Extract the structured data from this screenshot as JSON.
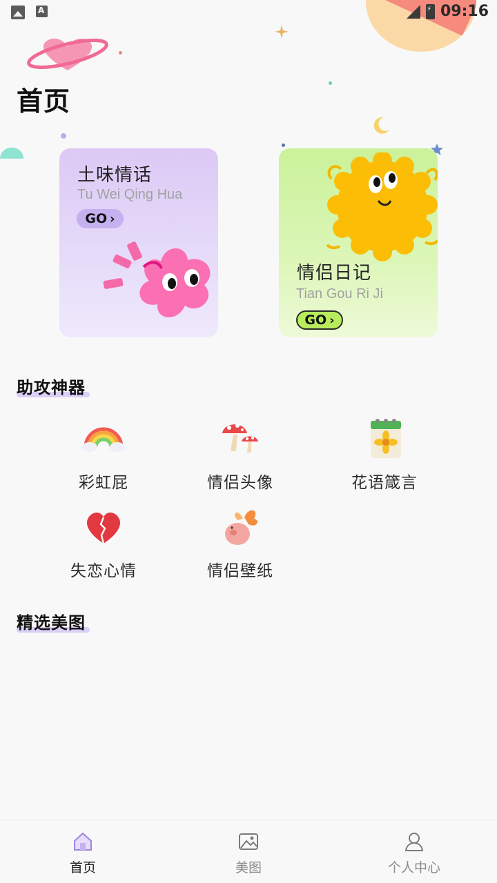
{
  "status_bar": {
    "time": "09:16"
  },
  "header": {
    "title": "首页"
  },
  "cards": [
    {
      "title": "土味情话",
      "subtitle": "Tu Wei Qing Hua",
      "go_label": "GO"
    },
    {
      "title": "情侣日记",
      "subtitle": "Tian Gou Ri Ji",
      "go_label": "GO"
    }
  ],
  "tools_section": {
    "title": "助攻神器",
    "items": [
      {
        "label": "彩虹屁",
        "icon": "rainbow-icon"
      },
      {
        "label": "情侣头像",
        "icon": "mushroom-icon"
      },
      {
        "label": "花语箴言",
        "icon": "flower-calendar-icon"
      },
      {
        "label": "失恋心情",
        "icon": "broken-heart-icon"
      },
      {
        "label": "情侣壁纸",
        "icon": "butterfly-pig-icon"
      }
    ]
  },
  "featured_section": {
    "title": "精选美图"
  },
  "tabbar": {
    "tabs": [
      {
        "label": "首页",
        "icon": "home-icon",
        "active": true
      },
      {
        "label": "美图",
        "icon": "image-icon",
        "active": false
      },
      {
        "label": "个人中心",
        "icon": "profile-icon",
        "active": false
      }
    ]
  },
  "colors": {
    "accent": "#c5b1f0",
    "green_card": "#cbf29a",
    "purple_card": "#dcc9f5"
  }
}
